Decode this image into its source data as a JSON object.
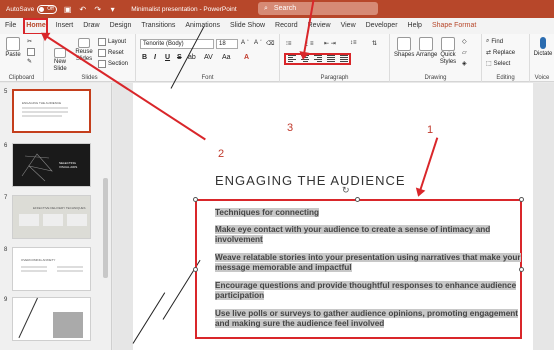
{
  "titlebar": {
    "autosave_label": "AutoSave",
    "autosave_state": "Off",
    "doc_title": "Minimalist presentation - PowerPoint",
    "search_placeholder": "Search"
  },
  "menu": {
    "tabs": [
      "File",
      "Home",
      "Insert",
      "Draw",
      "Design",
      "Transitions",
      "Animations",
      "Slide Show",
      "Record",
      "Review",
      "View",
      "Developer",
      "Help",
      "Shape Format"
    ],
    "active": "Home"
  },
  "ribbon": {
    "clipboard": {
      "label": "Clipboard",
      "paste": "Paste"
    },
    "slides": {
      "label": "Slides",
      "new_slide_1": "New",
      "new_slide_2": "Slide",
      "reuse_1": "Reuse",
      "reuse_2": "Slides",
      "layout": "Layout",
      "reset": "Reset",
      "section": "Section"
    },
    "font": {
      "label": "Font",
      "font_name": "Tenorite (Body)",
      "font_size": "18",
      "bold": "B",
      "italic": "I",
      "underline": "U",
      "strike": "S",
      "shadow": "ab",
      "spacing": "AV",
      "case": "Aa"
    },
    "paragraph": {
      "label": "Paragraph"
    },
    "drawing": {
      "label": "Drawing",
      "shapes": "Shapes",
      "arrange": "Arrange",
      "quick_styles_1": "Quick",
      "quick_styles_2": "Styles"
    },
    "editing": {
      "label": "Editing",
      "find": "Find",
      "replace": "Replace",
      "select": "Select"
    },
    "voice": {
      "label": "Voice",
      "dictate": "Dictate"
    }
  },
  "slides_panel": {
    "thumbs": [
      {
        "num": "5",
        "title": "ENGAGING THE AUDIENCE"
      },
      {
        "num": "6",
        "title": "SELECTING VISUAL AIDS"
      },
      {
        "num": "7",
        "title": "EFFECTIVE DELIVERY TECHNIQUES"
      },
      {
        "num": "8",
        "title": "OVERCOMING ANXIETY"
      },
      {
        "num": "9",
        "title": ""
      }
    ]
  },
  "slide": {
    "title": "ENGAGING THE AUDIENCE",
    "paragraphs": [
      "Techniques for connecting",
      "Make eye contact with your audience to create a sense of intimacy and involvement",
      "Weave relatable stories into your presentation using narratives that make your message memorable and impactful",
      "Encourage questions and provide thoughtful responses to enhance audience participation",
      "Use live polls or surveys to gather audience opinions, promoting engagement and making sure the audience feel involved"
    ]
  },
  "callouts": {
    "one": "1",
    "two": "2",
    "three": "3"
  },
  "colors": {
    "brand": "#b7472a",
    "callout": "#d9262a",
    "highlight": "#c8c8c8"
  }
}
